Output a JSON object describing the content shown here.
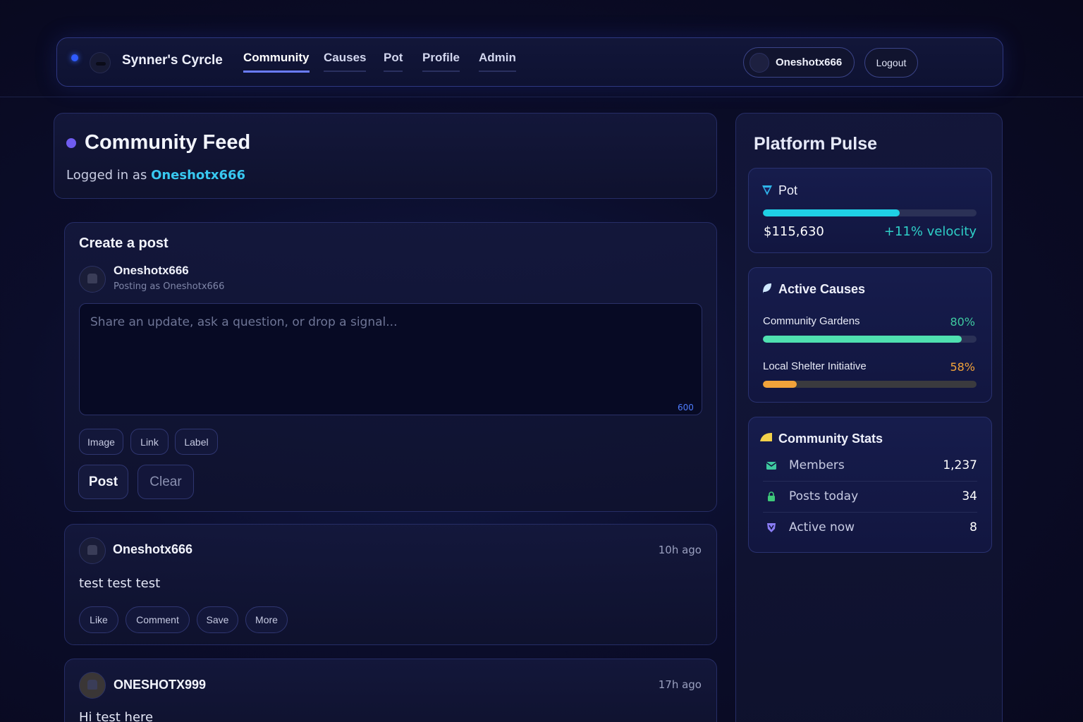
{
  "nav": {
    "brand": "Synner's Cyrcle",
    "links": [
      "Community",
      "Causes",
      "Pot",
      "Profile",
      "Admin"
    ],
    "active": "Community",
    "user": "Oneshotx666",
    "logout": "Logout"
  },
  "feed": {
    "title": "Community Feed",
    "logged_prefix": "Logged in as ",
    "logged_user": "Oneshotx666"
  },
  "composer": {
    "title": "Create a post",
    "user": "Oneshotx666",
    "posting_as": "Posting as Oneshotx666",
    "placeholder": "Share an update, ask a question, or drop a signal...",
    "counter": "600",
    "attach": [
      "Image",
      "Link",
      "Label"
    ],
    "post_label": "Post",
    "clear_label": "Clear"
  },
  "posts": [
    {
      "user": "Oneshotx666",
      "time": "10h ago",
      "body": "test test test",
      "actions": [
        "Like",
        "Comment",
        "Save",
        "More"
      ]
    },
    {
      "user": "ONESHOTX999",
      "time": "17h ago",
      "body": "Hi test here"
    }
  ],
  "sidebar": {
    "title": "Platform Pulse",
    "pot": {
      "label": "Pot",
      "amount": "$115,630",
      "velocity": "+11% velocity",
      "progress": 0.64,
      "color": "#1fd0e6"
    },
    "causes": {
      "title": "Active Causes",
      "items": [
        {
          "name": "Community Gardens",
          "pct_label": "80%",
          "progress": 0.93,
          "color": "#4fe0b0"
        },
        {
          "name": "Local Shelter Initiative",
          "pct_label": "58%",
          "progress": 0.16,
          "color": "#f2a33a"
        }
      ]
    },
    "stats": {
      "title": "Community Stats",
      "rows": [
        {
          "label": "Members",
          "value": "1,237",
          "icon": "envelope-icon",
          "color": "#3ec9a0"
        },
        {
          "label": "Posts today",
          "value": "34",
          "icon": "lock-icon",
          "color": "#3ec97a"
        },
        {
          "label": "Active now",
          "value": "8",
          "icon": "shield-icon",
          "color": "#8a7cf5"
        }
      ]
    }
  }
}
